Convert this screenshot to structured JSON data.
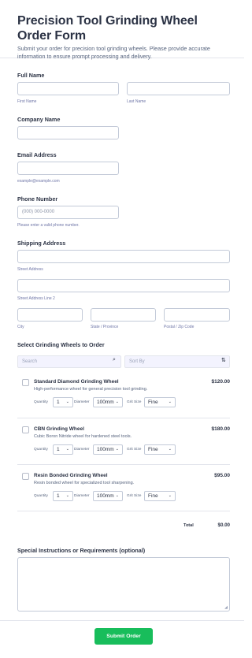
{
  "form": {
    "title": "Precision Tool Grinding Wheel Order Form",
    "subtitle": "Submit your order for precision tool grinding wheels. Please provide accurate information to ensure prompt processing and delivery."
  },
  "full_name": {
    "label": "Full Name",
    "first_sublabel": "First Name",
    "last_sublabel": "Last Name"
  },
  "company": {
    "label": "Company Name"
  },
  "email": {
    "label": "Email Address",
    "sublabel": "example@example.com"
  },
  "phone": {
    "label": "Phone Number",
    "placeholder": "(000) 000-0000",
    "sublabel": "Please enter a valid phone number."
  },
  "address": {
    "label": "Shipping Address",
    "street_sublabel": "Street Address",
    "street2_sublabel": "Street Address Line 2",
    "city_sublabel": "City",
    "state_sublabel": "State / Province",
    "postal_sublabel": "Postal / Zip Code"
  },
  "products_section": {
    "label": "Select Grinding Wheels to Order",
    "search_placeholder": "Search",
    "sort_placeholder": "Sort By"
  },
  "option_labels": {
    "quantity": "Quantity",
    "diameter": "Diameter",
    "grit": "Grit Size"
  },
  "products": [
    {
      "name": "Standard Diamond Grinding Wheel",
      "desc": "High-performance wheel for general precision tool grinding.",
      "price": "$120.00",
      "quantity": "1",
      "diameter": "100mm",
      "grit": "Fine"
    },
    {
      "name": "CBN Grinding Wheel",
      "desc": "Cubic Boron Nitride wheel for hardened steel tools.",
      "price": "$180.00",
      "quantity": "1",
      "diameter": "100mm",
      "grit": "Fine"
    },
    {
      "name": "Resin Bonded Grinding Wheel",
      "desc": "Resin bonded wheel for specialized tool sharpening.",
      "price": "$95.00",
      "quantity": "1",
      "diameter": "100mm",
      "grit": "Fine"
    }
  ],
  "total": {
    "label": "Total",
    "value": "$0.00"
  },
  "instructions": {
    "label": "Special Instructions or Requirements (optional)"
  },
  "submit": {
    "label": "Submit Order"
  },
  "colors": {
    "accent": "#18bd5b",
    "text": "#2c3345",
    "border": "#c3cad8"
  }
}
